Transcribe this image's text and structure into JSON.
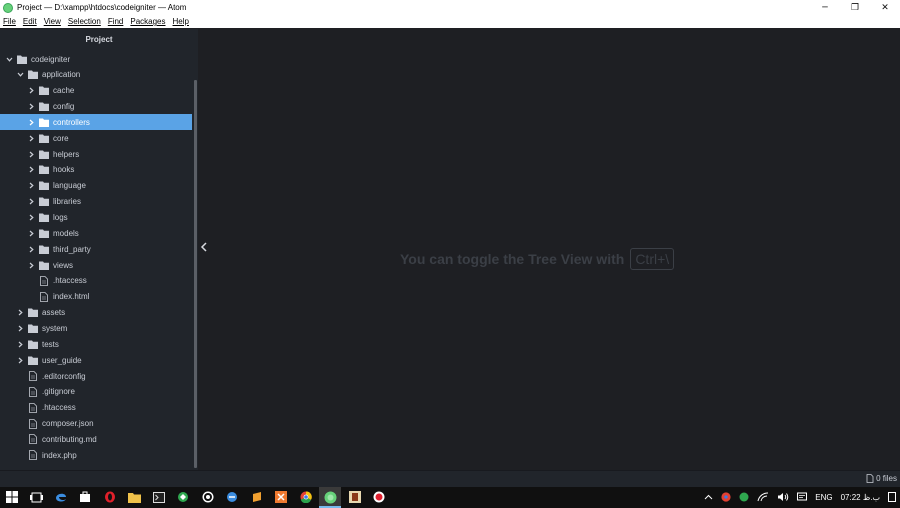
{
  "window": {
    "title": "Project — D:\\xampp\\htdocs\\codeigniter — Atom",
    "minimize": "─",
    "restore": "❐",
    "close": "✕"
  },
  "menu": [
    "File",
    "Edit",
    "View",
    "Selection",
    "Find",
    "Packages",
    "Help"
  ],
  "tree": {
    "header": "Project",
    "items": [
      {
        "label": "codeigniter",
        "type": "folder",
        "depth": 0,
        "expanded": true
      },
      {
        "label": "application",
        "type": "folder",
        "depth": 1,
        "expanded": true
      },
      {
        "label": "cache",
        "type": "folder",
        "depth": 2,
        "expanded": false
      },
      {
        "label": "config",
        "type": "folder",
        "depth": 2,
        "expanded": false
      },
      {
        "label": "controllers",
        "type": "folder",
        "depth": 2,
        "expanded": false,
        "selected": true
      },
      {
        "label": "core",
        "type": "folder",
        "depth": 2,
        "expanded": false
      },
      {
        "label": "helpers",
        "type": "folder",
        "depth": 2,
        "expanded": false
      },
      {
        "label": "hooks",
        "type": "folder",
        "depth": 2,
        "expanded": false
      },
      {
        "label": "language",
        "type": "folder",
        "depth": 2,
        "expanded": false
      },
      {
        "label": "libraries",
        "type": "folder",
        "depth": 2,
        "expanded": false
      },
      {
        "label": "logs",
        "type": "folder",
        "depth": 2,
        "expanded": false
      },
      {
        "label": "models",
        "type": "folder",
        "depth": 2,
        "expanded": false
      },
      {
        "label": "third_party",
        "type": "folder",
        "depth": 2,
        "expanded": false
      },
      {
        "label": "views",
        "type": "folder",
        "depth": 2,
        "expanded": false
      },
      {
        "label": ".htaccess",
        "type": "file",
        "depth": 2
      },
      {
        "label": "index.html",
        "type": "file",
        "depth": 2
      },
      {
        "label": "assets",
        "type": "folder",
        "depth": 1,
        "expanded": false
      },
      {
        "label": "system",
        "type": "folder",
        "depth": 1,
        "expanded": false
      },
      {
        "label": "tests",
        "type": "folder",
        "depth": 1,
        "expanded": false
      },
      {
        "label": "user_guide",
        "type": "folder",
        "depth": 1,
        "expanded": false
      },
      {
        "label": ".editorconfig",
        "type": "file",
        "depth": 1
      },
      {
        "label": ".gitignore",
        "type": "file",
        "depth": 1
      },
      {
        "label": ".htaccess",
        "type": "file",
        "depth": 1
      },
      {
        "label": "composer.json",
        "type": "file",
        "depth": 1
      },
      {
        "label": "contributing.md",
        "type": "file",
        "depth": 1
      },
      {
        "label": "index.php",
        "type": "file",
        "depth": 1
      }
    ]
  },
  "editor": {
    "hint": "You can toggle the Tree View with",
    "shortcut": "Ctrl+\\"
  },
  "status": {
    "files": "0 files"
  },
  "taskbar": {
    "lang": "ENG",
    "time": "07:22 ب.ظ",
    "apps": [
      "start-icon",
      "task-view-icon",
      "edge-icon",
      "store-icon",
      "opera-icon",
      "explorer-icon",
      "terminal-icon",
      "green-app-icon",
      "whatsapp-icon",
      "app-icon",
      "sublime-icon",
      "xampp-icon",
      "chrome-icon",
      "atom-icon",
      "app2-icon",
      "record-icon"
    ]
  },
  "colors": {
    "selected": "#5aa3e6",
    "tree_bg": "#21252b",
    "editor_bg": "#1e1f23",
    "folder": "#c8ccd4"
  }
}
